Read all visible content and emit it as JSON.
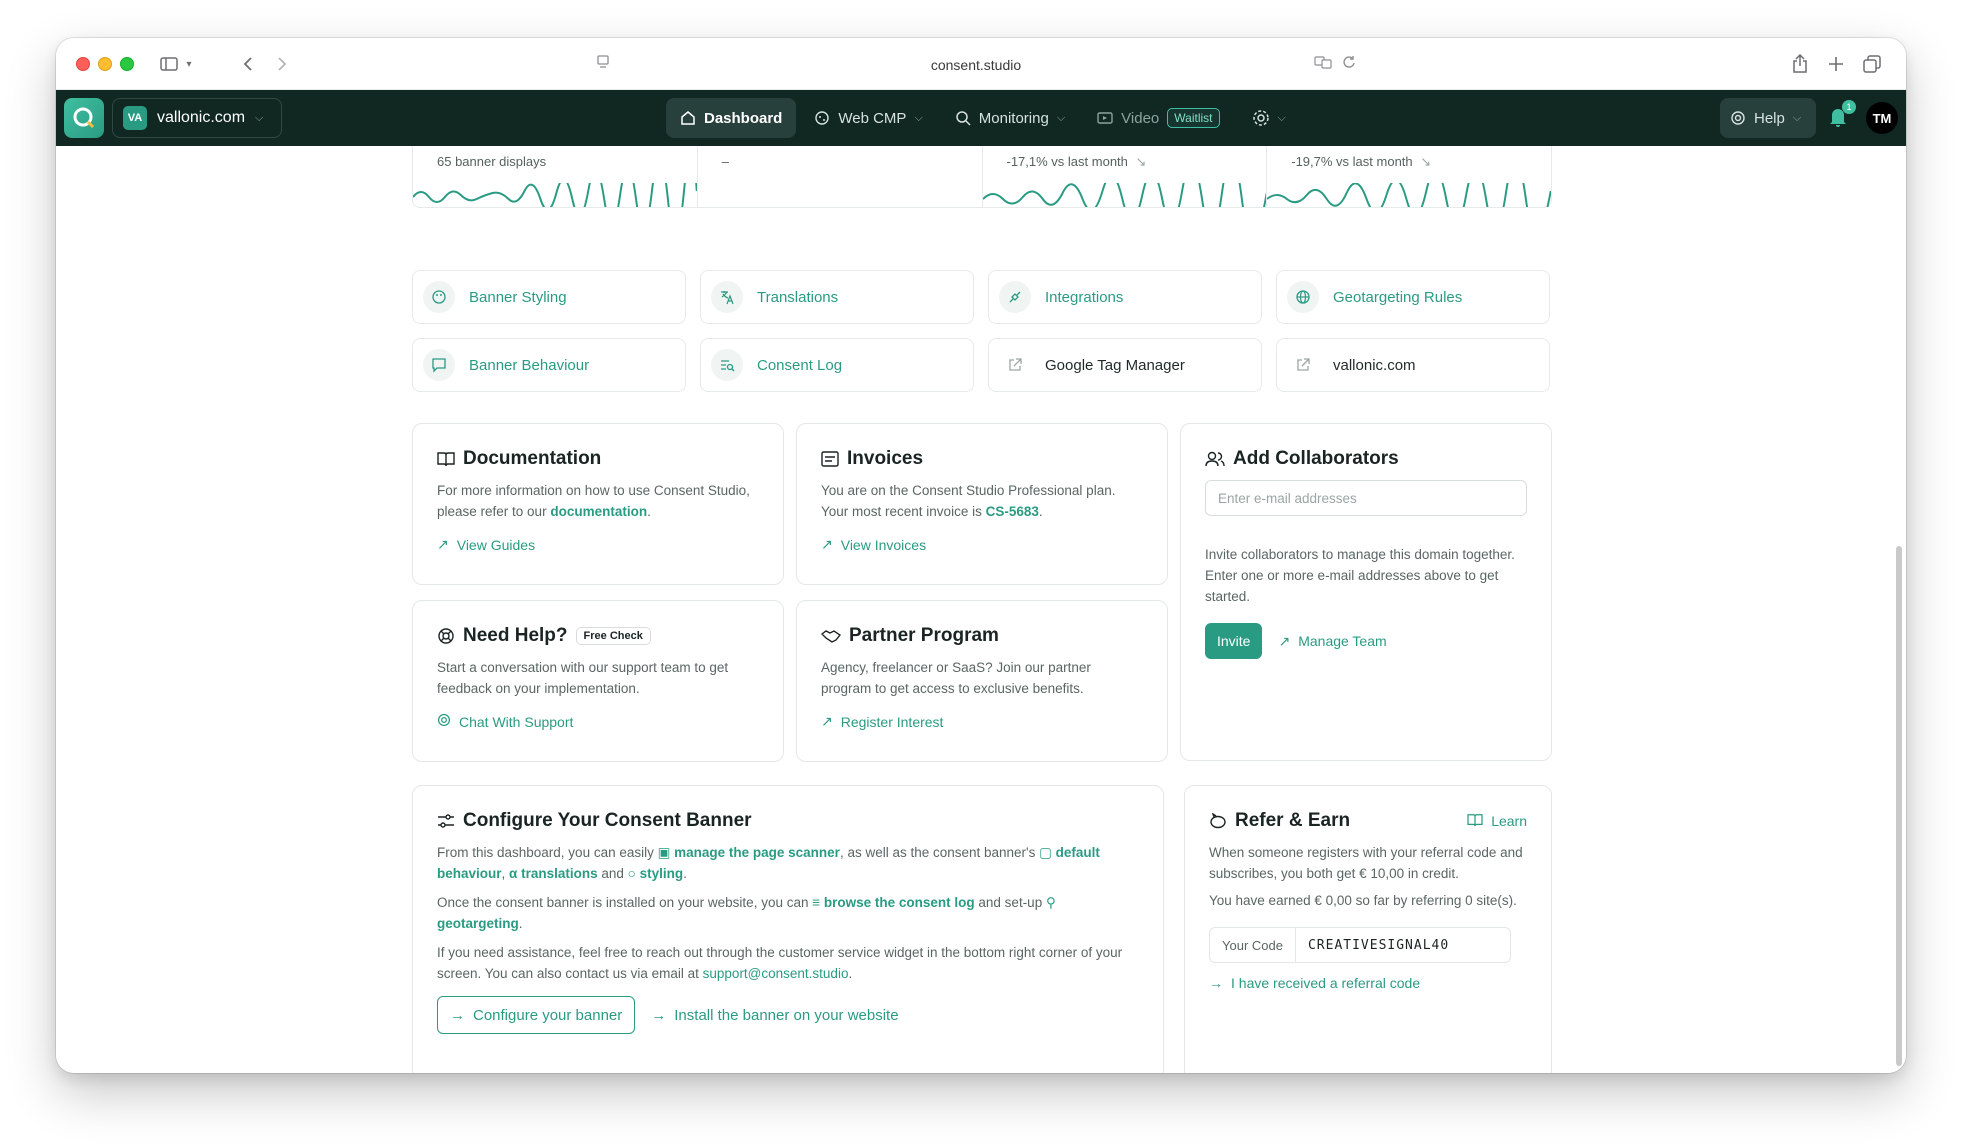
{
  "browser": {
    "url": "consent.studio"
  },
  "header": {
    "domain": "vallonic.com",
    "domain_initials": "VA",
    "nav": [
      {
        "label": "Dashboard"
      },
      {
        "label": "Web CMP"
      },
      {
        "label": "Monitoring"
      },
      {
        "label": "Video",
        "badge": "Waitlist"
      }
    ],
    "help_label": "Help",
    "notification_count": "1",
    "avatar_initials": "TM"
  },
  "stats": [
    {
      "text": "65 banner displays"
    },
    {
      "text": "–"
    },
    {
      "text": "-17,1% vs last month"
    },
    {
      "text": "-19,7% vs last month"
    }
  ],
  "quick_links": [
    {
      "label": "Banner Styling",
      "icon": "palette-icon"
    },
    {
      "label": "Translations",
      "icon": "translate-icon"
    },
    {
      "label": "Integrations",
      "icon": "plug-icon"
    },
    {
      "label": "Geotargeting Rules",
      "icon": "globe-icon"
    },
    {
      "label": "Banner Behaviour",
      "icon": "message-square-icon"
    },
    {
      "label": "Consent Log",
      "icon": "list-search-icon"
    },
    {
      "label": "Google Tag Manager",
      "icon": "external-link-icon"
    },
    {
      "label": "vallonic.com",
      "icon": "external-link-icon"
    }
  ],
  "documentation": {
    "title": "Documentation",
    "text_before": "For more information on how to use Consent Studio, please refer to our ",
    "link": "documentation",
    "text_after": ".",
    "action": "View Guides"
  },
  "invoices": {
    "title": "Invoices",
    "text_before": "You are on the Consent Studio Professional plan. Your most recent invoice is ",
    "link": "CS-5683",
    "text_after": ".",
    "action": "View Invoices"
  },
  "collaborators": {
    "title": "Add Collaborators",
    "placeholder": "Enter e-mail addresses",
    "description": "Invite collaborators to manage this domain together. Enter one or more e-mail addresses above to get started.",
    "invite_label": "Invite",
    "manage_label": "Manage Team"
  },
  "need_help": {
    "title": "Need Help?",
    "badge": "Free Check",
    "text": "Start a conversation with our support team to get feedback on your implementation.",
    "action": "Chat With Support"
  },
  "partner": {
    "title": "Partner Program",
    "text": "Agency, freelancer or SaaS? Join our partner program to get access to exclusive benefits.",
    "action": "Register Interest"
  },
  "configure": {
    "title": "Configure Your Consent Banner",
    "p1": {
      "a": "From this dashboard, you can easily ",
      "link1": "manage the page scanner",
      "b": ", as well as the consent banner's ",
      "link2": "default behaviour",
      "c": ", ",
      "link3": "translations",
      "d": " and ",
      "link4": "styling",
      "e": "."
    },
    "p2": {
      "a": "Once the consent banner is installed on your website, you can ",
      "link1": "browse the consent log",
      "b": " and set-up ",
      "link2": "geotargeting",
      "c": "."
    },
    "p3": {
      "a": "If you need assistance, feel free to reach out through the customer service widget in the bottom right corner of your screen. You can also contact us via email at ",
      "link": "support@consent.studio",
      "b": "."
    },
    "button_primary": "Configure your banner",
    "button_secondary": "Install the banner on your website"
  },
  "refer": {
    "title": "Refer & Earn",
    "learn_label": "Learn",
    "text1": "When someone registers with your referral code and subscribes, you both get € 10,00 in credit.",
    "text2": "You have earned € 0,00 so far by referring 0 site(s).",
    "code_label": "Your Code",
    "code_value": "CREATIVESIGNAL40",
    "received_link": "I have received a referral code"
  },
  "colors": {
    "header_bg": "#102722",
    "accent": "#2a9b83"
  }
}
